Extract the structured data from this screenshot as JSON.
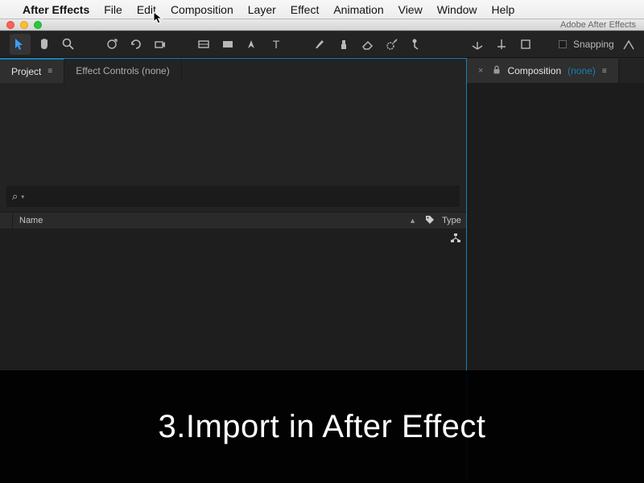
{
  "menubar": {
    "app_name": "After Effects",
    "items": [
      "File",
      "Edit",
      "Composition",
      "Layer",
      "Effect",
      "Animation",
      "View",
      "Window",
      "Help"
    ]
  },
  "window": {
    "title_right": "Adobe After Effects"
  },
  "toolbar": {
    "snapping_label": "Snapping"
  },
  "panels": {
    "project_tab": "Project",
    "effect_controls_tab": "Effect Controls (none)",
    "composition_tab_prefix": "Composition",
    "composition_tab_none": "(none)"
  },
  "project_panel": {
    "search_placeholder": "",
    "columns": {
      "name": "Name",
      "type": "Type"
    }
  },
  "caption": "3.Import in After Effect"
}
